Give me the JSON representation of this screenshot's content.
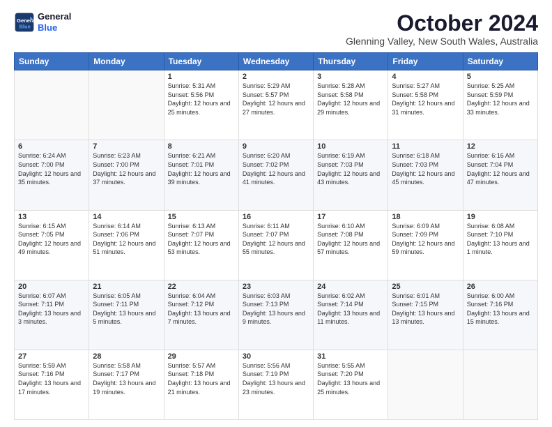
{
  "logo": {
    "line1": "General",
    "line2": "Blue"
  },
  "title": "October 2024",
  "location": "Glenning Valley, New South Wales, Australia",
  "headers": [
    "Sunday",
    "Monday",
    "Tuesday",
    "Wednesday",
    "Thursday",
    "Friday",
    "Saturday"
  ],
  "weeks": [
    [
      {
        "day": "",
        "content": ""
      },
      {
        "day": "",
        "content": ""
      },
      {
        "day": "1",
        "content": "Sunrise: 5:31 AM\nSunset: 5:56 PM\nDaylight: 12 hours and 25 minutes."
      },
      {
        "day": "2",
        "content": "Sunrise: 5:29 AM\nSunset: 5:57 PM\nDaylight: 12 hours and 27 minutes."
      },
      {
        "day": "3",
        "content": "Sunrise: 5:28 AM\nSunset: 5:58 PM\nDaylight: 12 hours and 29 minutes."
      },
      {
        "day": "4",
        "content": "Sunrise: 5:27 AM\nSunset: 5:58 PM\nDaylight: 12 hours and 31 minutes."
      },
      {
        "day": "5",
        "content": "Sunrise: 5:25 AM\nSunset: 5:59 PM\nDaylight: 12 hours and 33 minutes."
      }
    ],
    [
      {
        "day": "6",
        "content": "Sunrise: 6:24 AM\nSunset: 7:00 PM\nDaylight: 12 hours and 35 minutes."
      },
      {
        "day": "7",
        "content": "Sunrise: 6:23 AM\nSunset: 7:00 PM\nDaylight: 12 hours and 37 minutes."
      },
      {
        "day": "8",
        "content": "Sunrise: 6:21 AM\nSunset: 7:01 PM\nDaylight: 12 hours and 39 minutes."
      },
      {
        "day": "9",
        "content": "Sunrise: 6:20 AM\nSunset: 7:02 PM\nDaylight: 12 hours and 41 minutes."
      },
      {
        "day": "10",
        "content": "Sunrise: 6:19 AM\nSunset: 7:03 PM\nDaylight: 12 hours and 43 minutes."
      },
      {
        "day": "11",
        "content": "Sunrise: 6:18 AM\nSunset: 7:03 PM\nDaylight: 12 hours and 45 minutes."
      },
      {
        "day": "12",
        "content": "Sunrise: 6:16 AM\nSunset: 7:04 PM\nDaylight: 12 hours and 47 minutes."
      }
    ],
    [
      {
        "day": "13",
        "content": "Sunrise: 6:15 AM\nSunset: 7:05 PM\nDaylight: 12 hours and 49 minutes."
      },
      {
        "day": "14",
        "content": "Sunrise: 6:14 AM\nSunset: 7:06 PM\nDaylight: 12 hours and 51 minutes."
      },
      {
        "day": "15",
        "content": "Sunrise: 6:13 AM\nSunset: 7:07 PM\nDaylight: 12 hours and 53 minutes."
      },
      {
        "day": "16",
        "content": "Sunrise: 6:11 AM\nSunset: 7:07 PM\nDaylight: 12 hours and 55 minutes."
      },
      {
        "day": "17",
        "content": "Sunrise: 6:10 AM\nSunset: 7:08 PM\nDaylight: 12 hours and 57 minutes."
      },
      {
        "day": "18",
        "content": "Sunrise: 6:09 AM\nSunset: 7:09 PM\nDaylight: 12 hours and 59 minutes."
      },
      {
        "day": "19",
        "content": "Sunrise: 6:08 AM\nSunset: 7:10 PM\nDaylight: 13 hours and 1 minute."
      }
    ],
    [
      {
        "day": "20",
        "content": "Sunrise: 6:07 AM\nSunset: 7:11 PM\nDaylight: 13 hours and 3 minutes."
      },
      {
        "day": "21",
        "content": "Sunrise: 6:05 AM\nSunset: 7:11 PM\nDaylight: 13 hours and 5 minutes."
      },
      {
        "day": "22",
        "content": "Sunrise: 6:04 AM\nSunset: 7:12 PM\nDaylight: 13 hours and 7 minutes."
      },
      {
        "day": "23",
        "content": "Sunrise: 6:03 AM\nSunset: 7:13 PM\nDaylight: 13 hours and 9 minutes."
      },
      {
        "day": "24",
        "content": "Sunrise: 6:02 AM\nSunset: 7:14 PM\nDaylight: 13 hours and 11 minutes."
      },
      {
        "day": "25",
        "content": "Sunrise: 6:01 AM\nSunset: 7:15 PM\nDaylight: 13 hours and 13 minutes."
      },
      {
        "day": "26",
        "content": "Sunrise: 6:00 AM\nSunset: 7:16 PM\nDaylight: 13 hours and 15 minutes."
      }
    ],
    [
      {
        "day": "27",
        "content": "Sunrise: 5:59 AM\nSunset: 7:16 PM\nDaylight: 13 hours and 17 minutes."
      },
      {
        "day": "28",
        "content": "Sunrise: 5:58 AM\nSunset: 7:17 PM\nDaylight: 13 hours and 19 minutes."
      },
      {
        "day": "29",
        "content": "Sunrise: 5:57 AM\nSunset: 7:18 PM\nDaylight: 13 hours and 21 minutes."
      },
      {
        "day": "30",
        "content": "Sunrise: 5:56 AM\nSunset: 7:19 PM\nDaylight: 13 hours and 23 minutes."
      },
      {
        "day": "31",
        "content": "Sunrise: 5:55 AM\nSunset: 7:20 PM\nDaylight: 13 hours and 25 minutes."
      },
      {
        "day": "",
        "content": ""
      },
      {
        "day": "",
        "content": ""
      }
    ]
  ]
}
